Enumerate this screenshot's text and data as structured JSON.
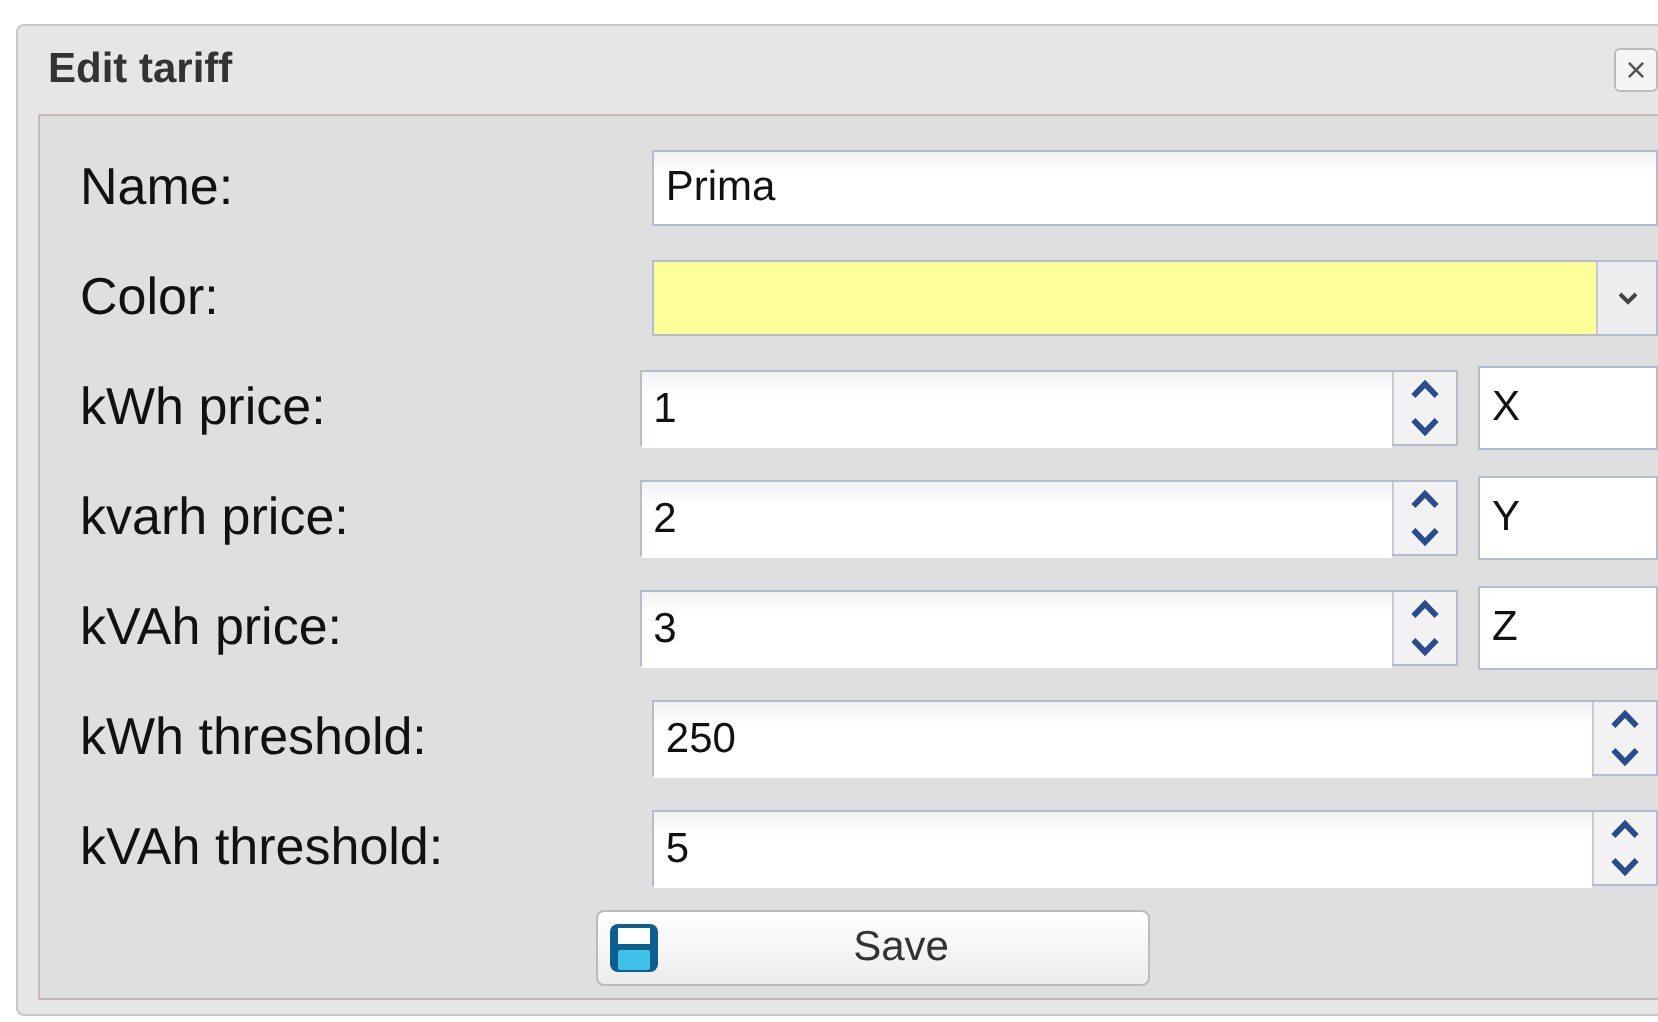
{
  "dialog": {
    "title": "Edit tariff",
    "close": "×"
  },
  "fields": [
    {
      "label": "Name:",
      "kind": "text",
      "value": "Prima"
    },
    {
      "label": "Color:",
      "kind": "color",
      "color": "#ffff99"
    },
    {
      "label": "kWh price:",
      "kind": "number",
      "value": "1",
      "unit": "X"
    },
    {
      "label": "kvarh price:",
      "kind": "number",
      "value": "2",
      "unit": "Y"
    },
    {
      "label": "kVAh price:",
      "kind": "number",
      "value": "3",
      "unit": "Z"
    },
    {
      "label": "kWh threshold:",
      "kind": "number",
      "value": "250"
    },
    {
      "label": "kVAh threshold:",
      "kind": "number",
      "value": "5"
    }
  ],
  "save_button": "Save"
}
